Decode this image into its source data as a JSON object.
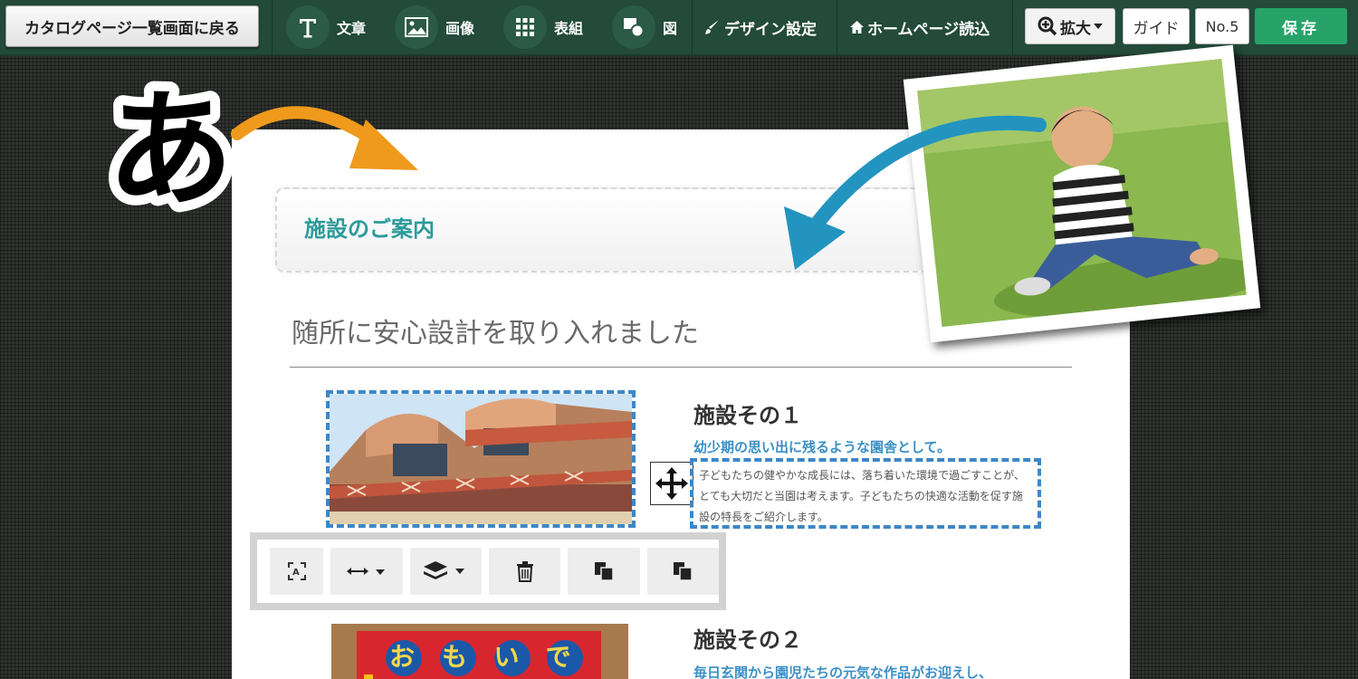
{
  "toolbar": {
    "back_label": "カタログページ一覧画面に戻る",
    "tools": [
      {
        "label": "文章",
        "icon": "text-T-icon"
      },
      {
        "label": "画像",
        "icon": "image-icon"
      },
      {
        "label": "表組",
        "icon": "table-grid-icon"
      },
      {
        "label": "図",
        "icon": "shapes-icon"
      }
    ],
    "design_label": "デザイン設定",
    "homepage_label": "ホームページ読込",
    "zoom_label": "拡大",
    "guide_label": "ガイド",
    "number_label": "No.5",
    "save_label": "保存"
  },
  "decor": {
    "hiragana": "あ"
  },
  "page": {
    "section_title": "施設のご案内",
    "heading": "随所に安心設計を取り入れました",
    "facility1": {
      "title": "施設その１",
      "subtitle": "幼少期の思い出に残るような園舎として。",
      "body": "子どもたちの健やかな成長には、落ち着いた環境で過ごすことが、とても大切だと当園は考えます。子どもたちの快適な活動を促す施設の特長をご紹介します。"
    },
    "facility2": {
      "title": "施設その２",
      "subtitle": "毎日玄関から園児たちの元気な作品がお迎えし、",
      "sign_text": "おもいで"
    }
  },
  "palette": {
    "buttons": [
      "resize-icon",
      "align-width-icon",
      "layers-icon",
      "trash-icon",
      "copy-icon",
      "paste-icon"
    ]
  },
  "colors": {
    "toolbar_bg": "#234a3a",
    "accent_teal": "#2e9a9a",
    "accent_blue": "#3a8fc6",
    "save_green": "#27a36a",
    "arrow_orange": "#ef9a1c",
    "arrow_blue": "#2394c0"
  }
}
